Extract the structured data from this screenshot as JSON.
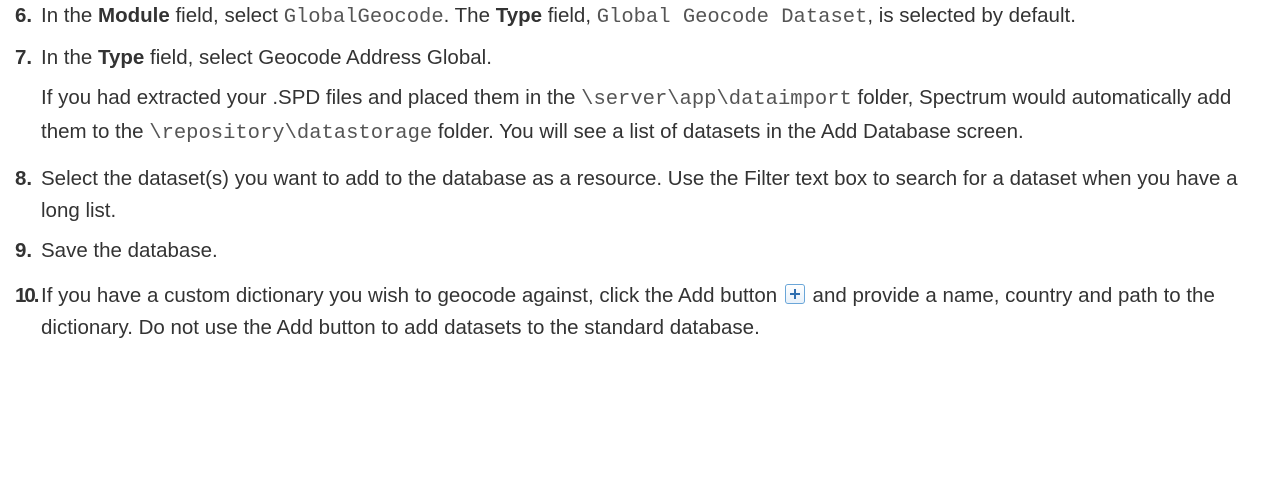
{
  "steps": [
    {
      "number": "6.",
      "t1": "In the ",
      "b1": "Module",
      "t2": " field, select ",
      "c1": "GlobalGeocode",
      "t3": ". The ",
      "b2": "Type",
      "t4": " field, ",
      "c2": "Global Geocode Dataset",
      "t5": ", is selected by default."
    },
    {
      "number": "7.",
      "t1": "In the ",
      "b1": "Type",
      "t2": " field, select Geocode Address Global.",
      "para": {
        "t1": "If you had extracted your .SPD files and placed them in the ",
        "c1": "\\server\\app\\dataimport",
        "t2": " folder, Spectrum would automatically add them to the ",
        "c2": "\\repository\\datastorage",
        "t3": " folder. You will see a list of datasets in the Add Database screen."
      }
    },
    {
      "number": "8.",
      "text": "Select the dataset(s) you want to add to the database as a resource. Use the Filter text box to search for a dataset when you have a long list."
    },
    {
      "number": "9.",
      "text": "Save the database."
    },
    {
      "number": "10.",
      "t1": "If you have a custom dictionary you wish to geocode against, click the Add button ",
      "icon": "plus-add-icon",
      "t2": " and provide a name, country and path to the dictionary. Do not use the Add button to add datasets to the standard database."
    }
  ]
}
